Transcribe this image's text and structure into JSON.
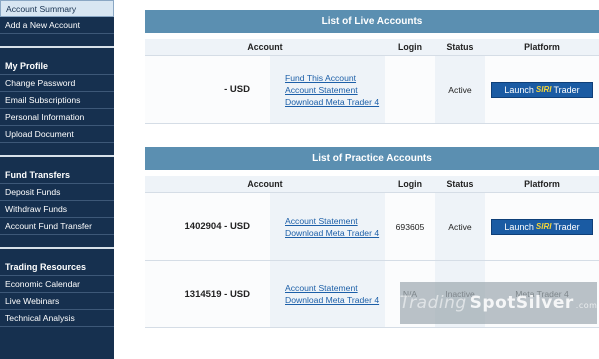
{
  "sidebar": {
    "account_summary": "Account Summary",
    "add_account": "Add a New Account",
    "profile_heading": "My Profile",
    "profile_items": [
      "Change Password",
      "Email Subscriptions",
      "Personal Information",
      "Upload Document"
    ],
    "funds_heading": "Fund Transfers",
    "funds_items": [
      "Deposit Funds",
      "Withdraw Funds",
      "Account Fund Transfer"
    ],
    "resources_heading": "Trading Resources",
    "resources_items": [
      "Economic Calendar",
      "Live Webinars",
      "Technical Analysis"
    ]
  },
  "columns": {
    "account": "Account",
    "login": "Login",
    "status": "Status",
    "platform": "Platform"
  },
  "live": {
    "title": "List of Live Accounts",
    "rows": [
      {
        "account": "- USD",
        "links": [
          "Fund This Account",
          "Account Statement",
          "Download Meta Trader 4"
        ],
        "login": "",
        "status": "Active",
        "launch": {
          "pre": "Launch",
          "logo": "SIRI",
          "post": "Trader"
        }
      }
    ]
  },
  "practice": {
    "title": "List of Practice Accounts",
    "rows": [
      {
        "account": "1402904 - USD",
        "links": [
          "Account Statement",
          "Download Meta Trader 4"
        ],
        "login": "693605",
        "status": "Active",
        "launch": {
          "pre": "Launch",
          "logo": "SIRI",
          "post": "Trader"
        }
      },
      {
        "account": "1314519 - USD",
        "links": [
          "Account Statement",
          "Download Meta Trader 4"
        ],
        "login": "N/A",
        "status": "Inactive",
        "platform_text": "Meta Trader 4"
      }
    ]
  },
  "watermark": {
    "light": "Trading",
    "bold": "SpotSilver",
    "domain": ".com"
  },
  "colors": {
    "sidebar_bg": "#16304f",
    "section_header": "#5b8fb1",
    "launch_button": "#1a5ba3",
    "link": "#1c5fa8"
  }
}
